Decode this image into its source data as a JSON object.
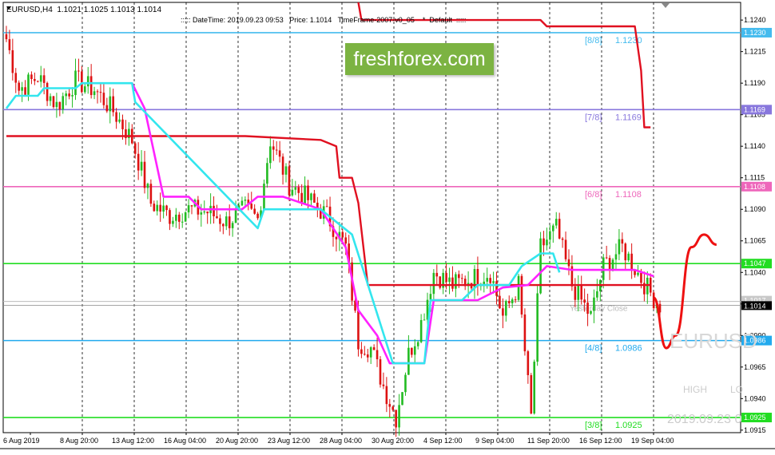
{
  "header": {
    "symbol_info": "EURUSD,H4  1.1021 1.1025 1.1013 1.1014",
    "indicator_info": "::::: DateTime: 2019.09.23 09:53   Price: 1.1014   TimeFrame-2007-v0_05    *  Default  :::::"
  },
  "watermark": {
    "brand": "freshforex.com",
    "symbol": "EURUSD",
    "high_label": "HIGH",
    "low_label": "LO",
    "datetime": "2019.09.23 0"
  },
  "colors": {
    "bull": "#22bb22",
    "bear": "#dd1111",
    "cyan_line": "#33e6ee",
    "magenta_line": "#ff22ff",
    "red_line": "#e01020",
    "badge": "#7cb342"
  },
  "chart_data": {
    "type": "candlestick",
    "symbol": "EURUSD",
    "timeframe": "H4",
    "ylim": [
      1.0913,
      1.1254
    ],
    "x_ticks": [
      "6 Aug 2019",
      "8 Aug 20:00",
      "13 Aug 12:00",
      "16 Aug 04:00",
      "20 Aug 20:00",
      "23 Aug 12:00",
      "28 Aug 04:00",
      "30 Aug 20:00",
      "4 Sep 12:00",
      "9 Sep 04:00",
      "11 Sep 20:00",
      "16 Sep 12:00",
      "19 Sep 04:00"
    ],
    "y_ticks": [
      "1.1240",
      "1.1215",
      "1.1190",
      "1.1165",
      "1.1140",
      "1.1115",
      "1.1090",
      "1.1065",
      "1.1040",
      "1.1015",
      "1.0990",
      "1.0965",
      "1.0940",
      "1.0915"
    ],
    "close_path": [
      [
        0,
        1.1225
      ],
      [
        4,
        1.1185
      ],
      [
        10,
        1.1195
      ],
      [
        16,
        1.1172
      ],
      [
        22,
        1.1192
      ],
      [
        28,
        1.1185
      ],
      [
        34,
        1.1168
      ],
      [
        40,
        1.1145
      ],
      [
        46,
        1.1095
      ],
      [
        52,
        1.1085
      ],
      [
        58,
        1.109
      ],
      [
        64,
        1.1088
      ],
      [
        70,
        1.108
      ],
      [
        76,
        1.109
      ],
      [
        80,
        1.1082
      ],
      [
        84,
        1.1145
      ],
      [
        90,
        1.111
      ],
      [
        96,
        1.1098
      ],
      [
        102,
        1.1085
      ],
      [
        108,
        1.106
      ],
      [
        112,
        1.0985
      ],
      [
        116,
        1.098
      ],
      [
        120,
        1.095
      ],
      [
        124,
        1.0925
      ],
      [
        128,
        1.0975
      ],
      [
        132,
        1.1
      ],
      [
        136,
        1.104
      ],
      [
        142,
        1.103
      ],
      [
        148,
        1.1035
      ],
      [
        154,
        1.104
      ],
      [
        158,
        1.1005
      ],
      [
        163,
        1.103
      ],
      [
        167,
        1.0925
      ],
      [
        170,
        1.106
      ],
      [
        175,
        1.1075
      ],
      [
        180,
        1.103
      ],
      [
        186,
        1.1005
      ],
      [
        190,
        1.1045
      ],
      [
        196,
        1.106
      ],
      [
        202,
        1.1035
      ],
      [
        206,
        1.102
      ],
      [
        208,
        1.1014
      ]
    ],
    "bar_count": 209,
    "levels": [
      {
        "label": "[8/8]",
        "value": 1.123,
        "tag": "1.1230",
        "color": "#44bbee"
      },
      {
        "label": "[7/8]",
        "value": 1.1169,
        "tag": "1.1169",
        "color": "#8877dd"
      },
      {
        "label": "[6/8]",
        "value": 1.1108,
        "tag": "1.1108",
        "color": "#ee66bb"
      },
      {
        "label": "",
        "value": 1.1047,
        "tag": "1.1047",
        "color": "#22dd22"
      },
      {
        "label": "[4/8]",
        "value": 1.0986,
        "tag": "1.0986",
        "color": "#22aaee"
      },
      {
        "label": "[3/8]",
        "value": 1.0925,
        "tag": "1.0925",
        "color": "#22dd22"
      }
    ],
    "current_price": {
      "value": 1.1014,
      "tag": "1.1014"
    },
    "yesterday_close": {
      "label": "Yesterday Close",
      "value": 1.1017,
      "tag": "1.1017"
    },
    "cyan_line": [
      [
        0,
        1.117
      ],
      [
        3,
        1.118
      ],
      [
        10,
        1.118
      ],
      [
        12,
        1.1186
      ],
      [
        22,
        1.1186
      ],
      [
        24,
        1.119
      ],
      [
        40,
        1.119
      ],
      [
        41,
        1.1175
      ],
      [
        80,
        1.1075
      ],
      [
        82,
        1.109
      ],
      [
        100,
        1.109
      ],
      [
        110,
        1.107
      ],
      [
        123,
        1.0968
      ],
      [
        128,
        1.0968
      ],
      [
        133,
        1.0968
      ],
      [
        135,
        1.1018
      ],
      [
        145,
        1.1018
      ],
      [
        150,
        1.103
      ],
      [
        160,
        1.103
      ],
      [
        164,
        1.1045
      ],
      [
        170,
        1.1055
      ],
      [
        174,
        1.1055
      ],
      [
        176,
        1.104
      ]
    ],
    "magenta_line": [
      [
        40,
        1.119
      ],
      [
        44,
        1.117
      ],
      [
        50,
        1.11
      ],
      [
        58,
        1.11
      ],
      [
        62,
        1.109
      ],
      [
        75,
        1.109
      ],
      [
        80,
        1.11
      ],
      [
        88,
        1.11
      ],
      [
        100,
        1.109
      ],
      [
        108,
        1.106
      ],
      [
        112,
        1.101
      ],
      [
        118,
        1.099
      ],
      [
        122,
        1.0968
      ],
      [
        133,
        1.0968
      ],
      [
        136,
        1.1018
      ],
      [
        150,
        1.1018
      ],
      [
        158,
        1.1028
      ],
      [
        166,
        1.103
      ],
      [
        172,
        1.1045
      ],
      [
        180,
        1.1042
      ],
      [
        200,
        1.1042
      ],
      [
        206,
        1.1037
      ]
    ],
    "red_line": [
      [
        0,
        1.1148
      ],
      [
        70,
        1.1148
      ],
      [
        76,
        1.1148
      ],
      [
        100,
        1.1145
      ],
      [
        105,
        1.114
      ],
      [
        106,
        1.1115
      ],
      [
        110,
        1.1115
      ],
      [
        112,
        1.1095
      ],
      [
        115,
        1.103
      ],
      [
        116,
        1.103
      ],
      [
        200,
        1.103
      ],
      [
        205,
        1.103
      ]
    ],
    "red_line_upper": [
      [
        112,
        1.1254
      ],
      [
        113,
        1.124
      ],
      [
        170,
        1.124
      ],
      [
        172,
        1.1235
      ],
      [
        200,
        1.1235
      ],
      [
        202,
        1.12
      ],
      [
        203,
        1.1155
      ],
      [
        205,
        1.1155
      ]
    ],
    "projection": [
      [
        206,
        1.102
      ],
      [
        210,
        1.098
      ],
      [
        213,
        1.099
      ],
      [
        218,
        1.106
      ],
      [
        222,
        1.107
      ],
      [
        226,
        1.1062
      ]
    ]
  }
}
